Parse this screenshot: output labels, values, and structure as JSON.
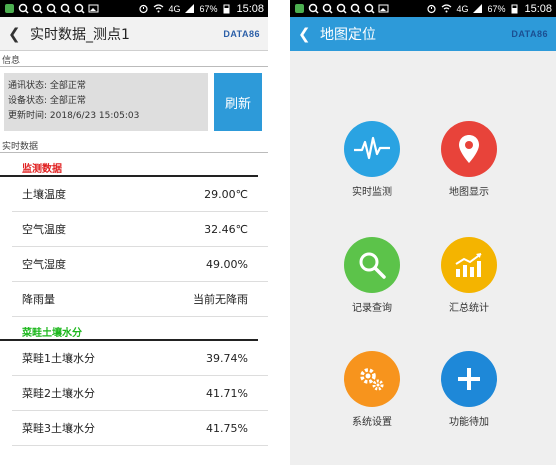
{
  "status_bar_left": {
    "signal_label": "4G",
    "battery_label": "67%",
    "time": "15:08"
  },
  "status_bar_right": {
    "signal_label": "4G",
    "battery_label": "67%",
    "time": "15:08"
  },
  "left_screen": {
    "title": "实时数据_测点1",
    "brand": "DATA86",
    "info_section_label": "信息",
    "info": {
      "comm_status": "通讯状态: 全部正常",
      "device_status": "设备状态: 全部正常",
      "update_time": "更新时间: 2018/6/23 15:05:03"
    },
    "refresh_label": "刷新",
    "realtime_section_label": "实时数据",
    "groups": [
      {
        "title": "监测数据",
        "color": "#e02020",
        "rows": [
          {
            "label": "土壤温度",
            "value": "29.00℃"
          },
          {
            "label": "空气温度",
            "value": "32.46℃"
          },
          {
            "label": "空气湿度",
            "value": "49.00%"
          },
          {
            "label": "降雨量",
            "value": "当前无降雨"
          }
        ]
      },
      {
        "title": "菜畦土壤水分",
        "color": "#1db81d",
        "rows": [
          {
            "label": "菜畦1土壤水分",
            "value": "39.74%"
          },
          {
            "label": "菜畦2土壤水分",
            "value": "41.71%"
          },
          {
            "label": "菜畦3土壤水分",
            "value": "41.75%"
          }
        ]
      }
    ]
  },
  "right_screen": {
    "title": "地图定位",
    "brand": "DATA86",
    "accent_color": "#2d9ad9",
    "tiles": [
      {
        "label": "实时监测",
        "icon": "heartbeat-icon",
        "color": "#2aa3e2"
      },
      {
        "label": "地图显示",
        "icon": "map-pin-icon",
        "color": "#e8433a"
      },
      {
        "label": "记录查询",
        "icon": "search-icon",
        "color": "#5cc34a"
      },
      {
        "label": "汇总统计",
        "icon": "bar-chart-icon",
        "color": "#f4b400"
      },
      {
        "label": "系统设置",
        "icon": "gears-icon",
        "color": "#f7941d"
      },
      {
        "label": "功能待加",
        "icon": "plus-icon",
        "color": "#1e88d8"
      }
    ]
  }
}
